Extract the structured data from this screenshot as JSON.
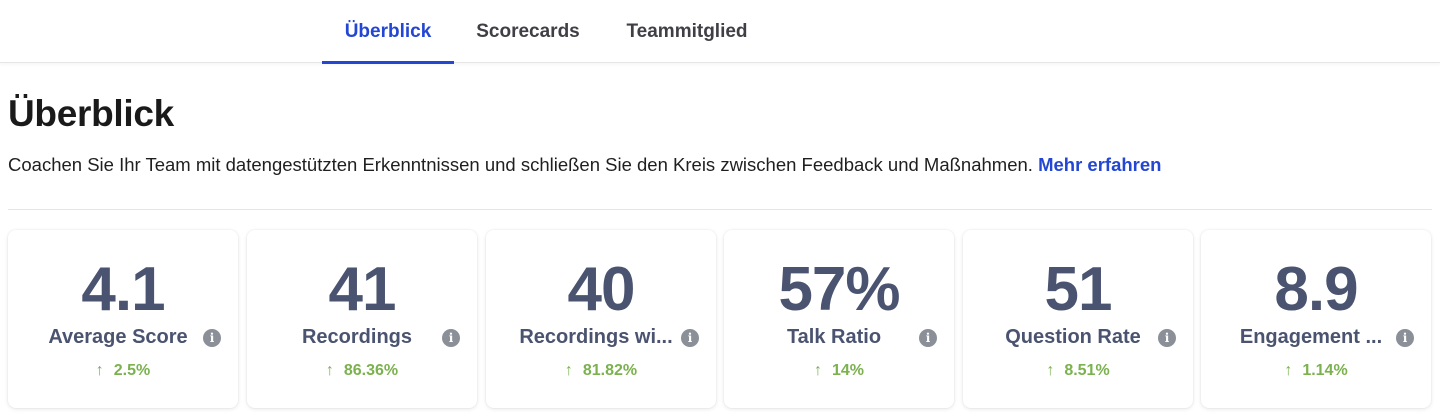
{
  "tabs": [
    {
      "label": "Überblick",
      "active": true
    },
    {
      "label": "Scorecards",
      "active": false
    },
    {
      "label": "Teammitglied",
      "active": false
    }
  ],
  "page": {
    "title": "Überblick",
    "description": "Coachen Sie Ihr Team mit datengestützten Erkenntnissen und schließen Sie den Kreis zwischen Feedback und Maßnahmen.",
    "learn_more": "Mehr erfahren"
  },
  "metrics": [
    {
      "value": "4.1",
      "label": "Average Score",
      "change": "2.5%"
    },
    {
      "value": "41",
      "label": "Recordings",
      "change": "86.36%"
    },
    {
      "value": "40",
      "label": "Recordings wi...",
      "change": "81.82%"
    },
    {
      "value": "57%",
      "label": "Talk Ratio",
      "change": "14%"
    },
    {
      "value": "51",
      "label": "Question Rate",
      "change": "8.51%"
    },
    {
      "value": "8.9",
      "label": "Engagement ...",
      "change": "1.14%"
    }
  ],
  "icons": {
    "info": "info-icon",
    "trend_up": "arrow-up-icon"
  },
  "colors": {
    "accent": "#2346d3",
    "metric_text": "#4a5370",
    "positive": "#7bb14e"
  }
}
